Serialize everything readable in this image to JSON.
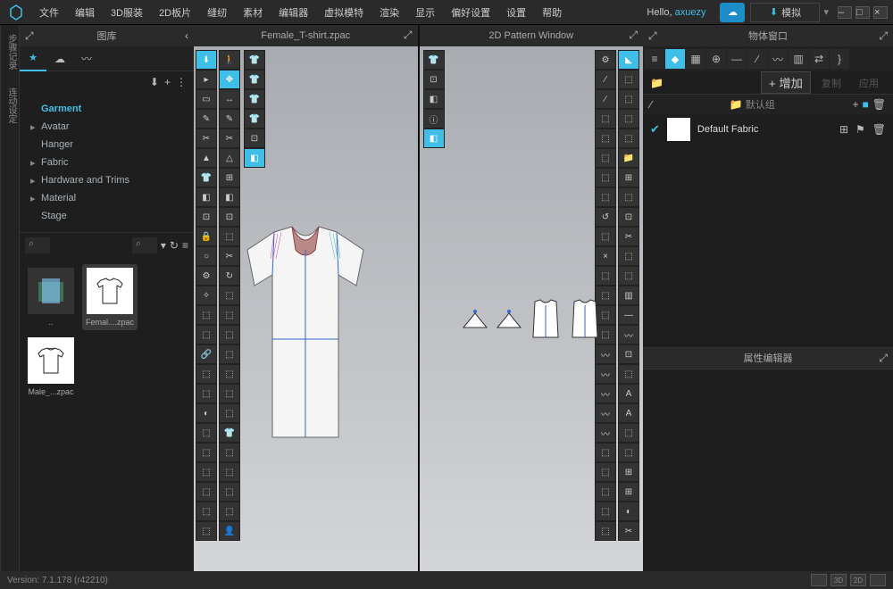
{
  "menu": {
    "items": [
      "文件",
      "编辑",
      "3D服装",
      "2D板片",
      "缝纫",
      "素材",
      "编辑器",
      "虚拟模特",
      "渲染",
      "显示",
      "偏好设置",
      "设置",
      "帮助"
    ]
  },
  "header": {
    "hello": "Hello, ",
    "user": "axuezy",
    "sim": "模拟"
  },
  "library": {
    "title": "图库",
    "tree": [
      {
        "label": "Garment",
        "active": true
      },
      {
        "label": "Avatar",
        "child": true
      },
      {
        "label": "Hanger"
      },
      {
        "label": "Fabric",
        "child": true
      },
      {
        "label": "Hardware and Trims",
        "child": true
      },
      {
        "label": "Material",
        "child": true
      },
      {
        "label": "Stage"
      }
    ],
    "thumbs": [
      {
        "label": "..",
        "type": "folder"
      },
      {
        "label": "Femal....zpac",
        "type": "shirt",
        "sel": true
      },
      {
        "label": "Male_...zpac",
        "type": "shirt"
      }
    ]
  },
  "views": {
    "v3d": "Female_T-shirt.zpac",
    "v2d": "2D Pattern Window"
  },
  "object": {
    "title": "物体窗口",
    "add": "+ 增加",
    "copy": "复制",
    "apply": "应用",
    "group": "默认组",
    "fabric": "Default Fabric"
  },
  "property": {
    "title": "属性编辑器"
  },
  "status": {
    "version": "Version: 7.1.178 (r42210)",
    "btns": [
      "",
      "3D",
      "2D",
      ""
    ]
  }
}
